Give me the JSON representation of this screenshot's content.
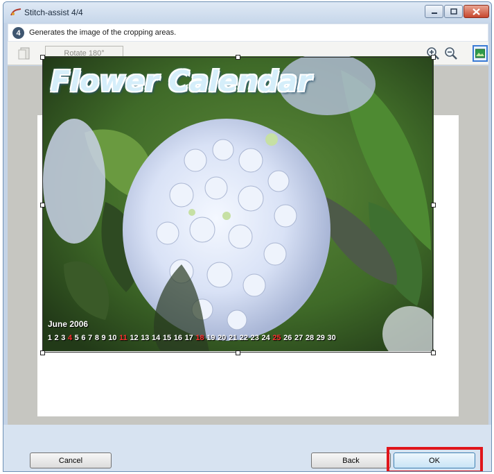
{
  "window": {
    "title": "Stitch-assist 4/4",
    "icons": {
      "app": "stitch-app-icon",
      "minimize": "minimize-icon",
      "maximize": "maximize-icon",
      "close": "close-icon"
    },
    "close_color": "#c7472e"
  },
  "step": {
    "number": "4",
    "text": "Generates the image of the cropping areas."
  },
  "toolbar": {
    "rotate_label": "Rotate 180°",
    "icons": [
      "rotate-icon",
      "zoom-in-icon",
      "zoom-out-icon",
      "fit-to-window-icon"
    ]
  },
  "preview": {
    "image_title": "Flower Calendar",
    "month_label": "June 2006",
    "days": [
      {
        "d": "1",
        "red": false
      },
      {
        "d": "2",
        "red": false
      },
      {
        "d": "3",
        "red": false
      },
      {
        "d": "4",
        "red": true
      },
      {
        "d": "5",
        "red": false
      },
      {
        "d": "6",
        "red": false
      },
      {
        "d": "7",
        "red": false
      },
      {
        "d": "8",
        "red": false
      },
      {
        "d": "9",
        "red": false
      },
      {
        "d": "10",
        "red": false
      },
      {
        "d": "11",
        "red": true
      },
      {
        "d": "12",
        "red": false
      },
      {
        "d": "13",
        "red": false
      },
      {
        "d": "14",
        "red": false
      },
      {
        "d": "15",
        "red": false
      },
      {
        "d": "16",
        "red": false
      },
      {
        "d": "17",
        "red": false
      },
      {
        "d": "18",
        "red": true
      },
      {
        "d": "19",
        "red": false
      },
      {
        "d": "20",
        "red": false
      },
      {
        "d": "21",
        "red": false
      },
      {
        "d": "22",
        "red": false
      },
      {
        "d": "23",
        "red": false
      },
      {
        "d": "24",
        "red": false
      },
      {
        "d": "25",
        "red": true
      },
      {
        "d": "26",
        "red": false
      },
      {
        "d": "27",
        "red": false
      },
      {
        "d": "28",
        "red": false
      },
      {
        "d": "29",
        "red": false
      },
      {
        "d": "30",
        "red": false
      }
    ]
  },
  "buttons": {
    "cancel": "Cancel",
    "back": "Back",
    "ok": "OK"
  },
  "colors": {
    "highlight": "#e0151b",
    "accent": "#3a7bd5"
  }
}
